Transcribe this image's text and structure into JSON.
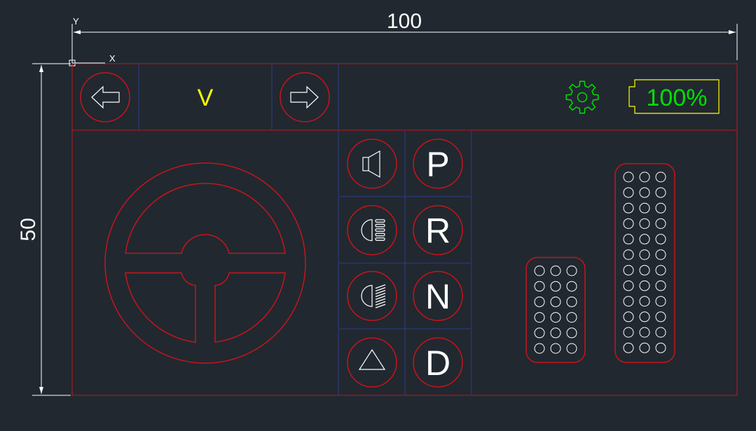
{
  "colors": {
    "background": "#212830",
    "outline": "#c8141a",
    "grid": "#2b3e86",
    "dimension": "#ffffff",
    "speed_text": "#ffff00",
    "gear_text": "#ffffff",
    "settings_icon": "#00e000",
    "battery_outline": "#ffff00",
    "battery_text": "#00e000"
  },
  "dimensions": {
    "width_label": "100",
    "height_label": "50"
  },
  "axes": {
    "y_label": "Y",
    "x_label": "X"
  },
  "top_bar": {
    "speed_label": "V",
    "battery_label": "100%",
    "icons": [
      "left-arrow-icon",
      "right-arrow-icon",
      "gear-icon",
      "battery-icon"
    ]
  },
  "controls": {
    "left_icons": [
      "horn-icon",
      "low-beam-icon",
      "high-beam-icon",
      "hazard-icon"
    ],
    "gears": [
      "P",
      "R",
      "N",
      "D"
    ]
  },
  "pedals": {
    "brake": {
      "rows": 6,
      "cols": 3
    },
    "accelerator": {
      "rows": 12,
      "cols": 3
    }
  }
}
